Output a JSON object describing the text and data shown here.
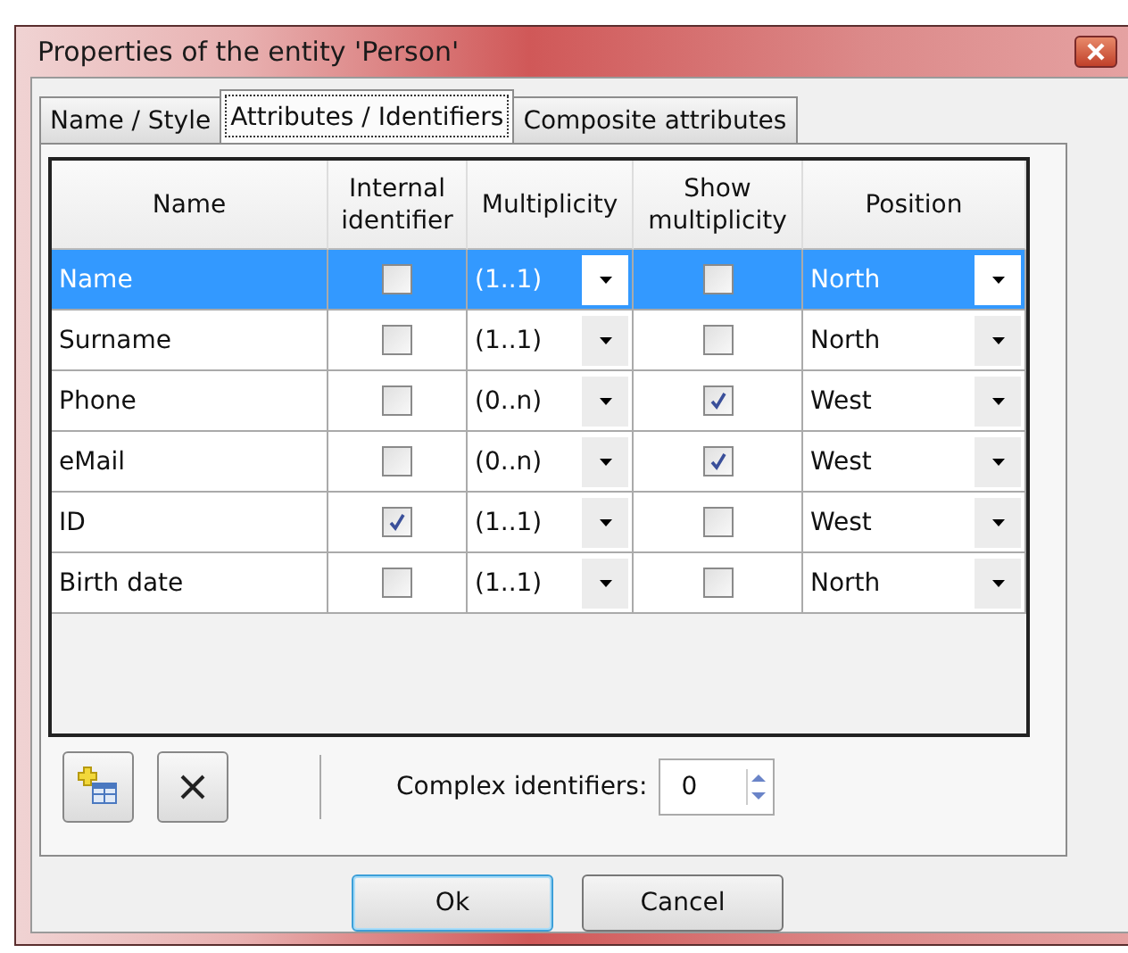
{
  "window": {
    "title": "Properties of the entity 'Person'"
  },
  "tabs": [
    {
      "label": "Name / Style",
      "selected": false
    },
    {
      "label": "Attributes / Identifiers",
      "selected": true
    },
    {
      "label": "Composite attributes",
      "selected": false
    }
  ],
  "table": {
    "columns": [
      "Name",
      "Internal identifier",
      "Multiplicity",
      "Show multiplicity",
      "Position"
    ],
    "rows": [
      {
        "name": "Name",
        "internal_identifier": false,
        "multiplicity": "(1..1)",
        "show_multiplicity": false,
        "position": "North",
        "selected": true
      },
      {
        "name": "Surname",
        "internal_identifier": false,
        "multiplicity": "(1..1)",
        "show_multiplicity": false,
        "position": "North",
        "selected": false
      },
      {
        "name": "Phone",
        "internal_identifier": false,
        "multiplicity": "(0..n)",
        "show_multiplicity": true,
        "position": "West",
        "selected": false
      },
      {
        "name": "eMail",
        "internal_identifier": false,
        "multiplicity": "(0..n)",
        "show_multiplicity": true,
        "position": "West",
        "selected": false
      },
      {
        "name": "ID",
        "internal_identifier": true,
        "multiplicity": "(1..1)",
        "show_multiplicity": false,
        "position": "West",
        "selected": false
      },
      {
        "name": "Birth date",
        "internal_identifier": false,
        "multiplicity": "(1..1)",
        "show_multiplicity": false,
        "position": "North",
        "selected": false
      }
    ]
  },
  "complex_identifiers": {
    "label": "Complex identifiers:",
    "value": "0"
  },
  "buttons": [
    "Ok",
    "Cancel"
  ]
}
